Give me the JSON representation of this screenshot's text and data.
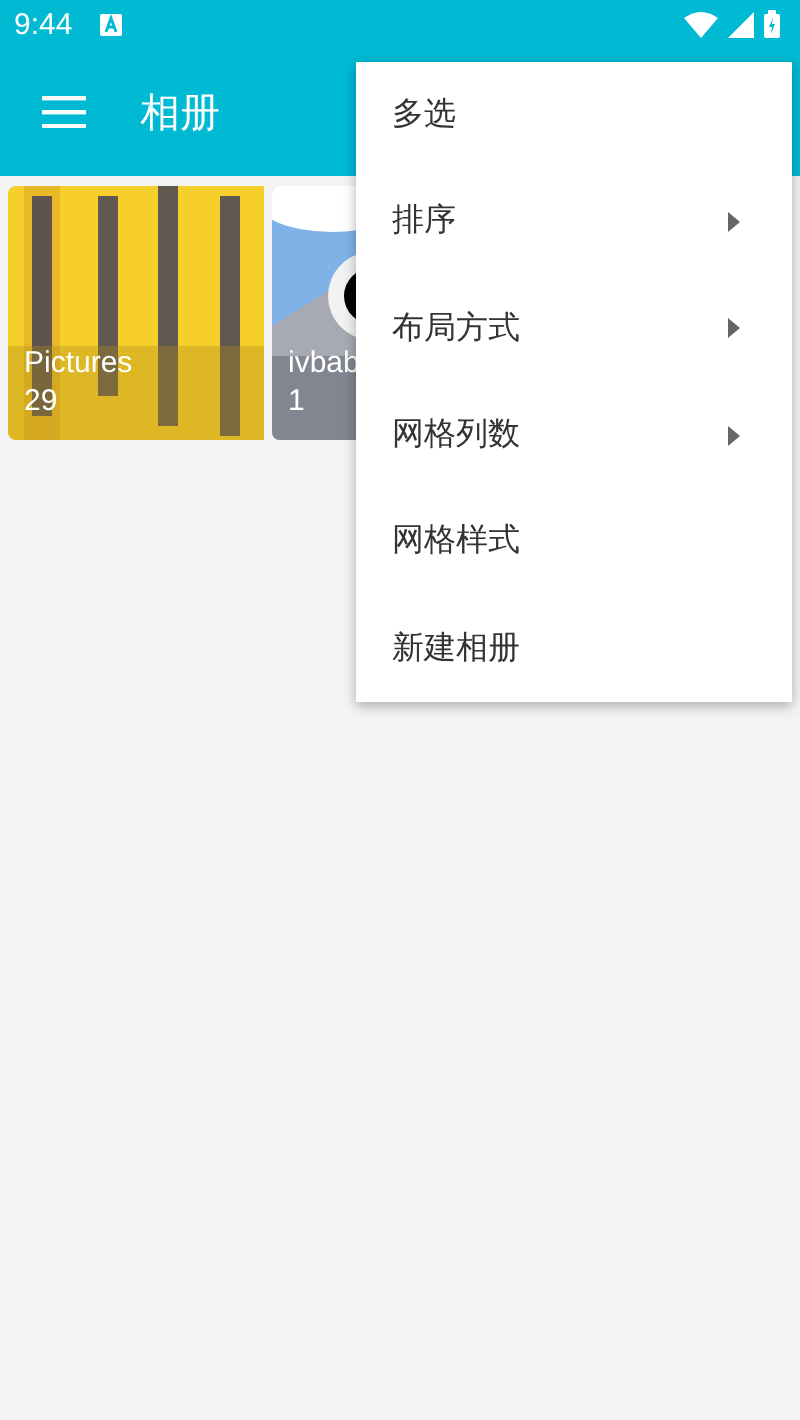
{
  "status_bar": {
    "time": "9:44"
  },
  "app_bar": {
    "title": "相册"
  },
  "albums": [
    {
      "name": "Pictures",
      "count": "29",
      "kind": "picture"
    },
    {
      "name": "ivbab",
      "count": "1",
      "kind": "picture"
    }
  ],
  "menu": [
    {
      "label": "多选",
      "has_submenu": false
    },
    {
      "label": "排序",
      "has_submenu": true
    },
    {
      "label": "布局方式",
      "has_submenu": true
    },
    {
      "label": "网格列数",
      "has_submenu": true
    },
    {
      "label": "网格样式",
      "has_submenu": false
    },
    {
      "label": "新建相册",
      "has_submenu": false
    }
  ]
}
